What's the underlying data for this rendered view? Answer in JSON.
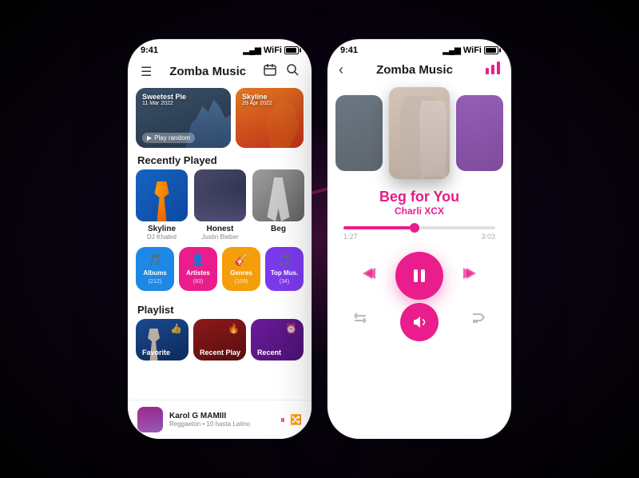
{
  "app": {
    "name": "Zomba Music",
    "status_time": "9:41"
  },
  "left_phone": {
    "header": {
      "title": "Zomba Music",
      "menu_icon": "☰",
      "calendar_icon": "📅",
      "search_icon": "🔍"
    },
    "banner": {
      "left": {
        "title": "Sweetest Pie",
        "date": "11 Mar 2022",
        "play_label": "Play random"
      },
      "right": {
        "title": "Skyline",
        "date": "29 Apr 2022"
      }
    },
    "recently_played": {
      "section_title": "Recently Played",
      "tracks": [
        {
          "name": "Skyline",
          "artist": "DJ Khaled"
        },
        {
          "name": "Honest",
          "artist": "Justin Bieber"
        },
        {
          "name": "Beg",
          "artist": ""
        }
      ]
    },
    "categories": [
      {
        "icon": "🎵",
        "label": "Albums",
        "count": "(212)",
        "color": "blue"
      },
      {
        "icon": "👤",
        "label": "Artistes",
        "count": "(83)",
        "color": "pink"
      },
      {
        "icon": "🎸",
        "label": "Genres",
        "count": "(109)",
        "color": "yellow"
      },
      {
        "icon": "🎵",
        "label": "Top Mus.",
        "count": "(34)",
        "color": "purple"
      }
    ],
    "playlist": {
      "section_title": "Playlist",
      "items": [
        {
          "label": "Favorite",
          "icon": "👍"
        },
        {
          "label": "Recent Play",
          "icon": "🔥"
        },
        {
          "label": "Recent",
          "icon": "⏰"
        }
      ]
    },
    "now_playing": {
      "title": "Karol G MAMIII",
      "artist": "Reggaeton • 10 hasta Latino",
      "pause_icon": "⏸",
      "shuffle_icon": "🔀"
    }
  },
  "right_phone": {
    "header": {
      "title": "Zomba Music",
      "back_icon": "‹",
      "chart_icon": "📊"
    },
    "song": {
      "title": "Beg for You",
      "artist": "Charli XCX"
    },
    "player": {
      "current_time": "1:27",
      "total_time": "3:03",
      "progress_percent": 47,
      "prev_icon": "⏮",
      "pause_icon": "⏸",
      "next_icon": "⏭",
      "repeat_icon": "🔁",
      "volume_icon": "🔊",
      "shuffle_icon": "🔀"
    }
  }
}
